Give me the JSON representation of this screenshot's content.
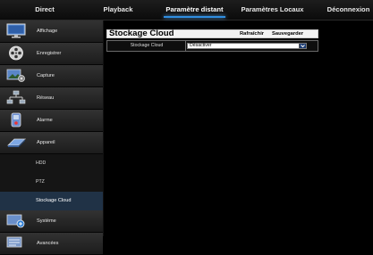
{
  "topnav": {
    "tabs": [
      {
        "label": "Direct"
      },
      {
        "label": "Playback"
      },
      {
        "label": "Paramètre distant"
      },
      {
        "label": "Paramètres Locaux"
      },
      {
        "label": "Déconnexion"
      }
    ],
    "active_index": 2,
    "accent_color": "#2f8de0"
  },
  "sidebar": {
    "items": [
      {
        "label": "Affichage",
        "icon": "monitor-icon"
      },
      {
        "label": "Enregistrer",
        "icon": "film-reel-icon"
      },
      {
        "label": "Capture",
        "icon": "capture-icon"
      },
      {
        "label": "Réseau",
        "icon": "network-icon"
      },
      {
        "label": "Alarme",
        "icon": "alarm-icon"
      },
      {
        "label": "Appareil",
        "icon": "device-icon"
      }
    ],
    "sub_items": [
      {
        "label": "HDD"
      },
      {
        "label": "PTZ"
      },
      {
        "label": "Stockage Cloud"
      }
    ],
    "active_sub": "Stockage Cloud",
    "bottom_items": [
      {
        "label": "Système",
        "icon": "system-icon"
      },
      {
        "label": "Avancées",
        "icon": "advanced-icon"
      }
    ]
  },
  "panel": {
    "title": "Stockage Cloud",
    "refresh_label": "Rafraîchir",
    "save_label": "Sauvegarder",
    "row_label": "Stockage Cloud",
    "select_value": "Désactiver"
  }
}
